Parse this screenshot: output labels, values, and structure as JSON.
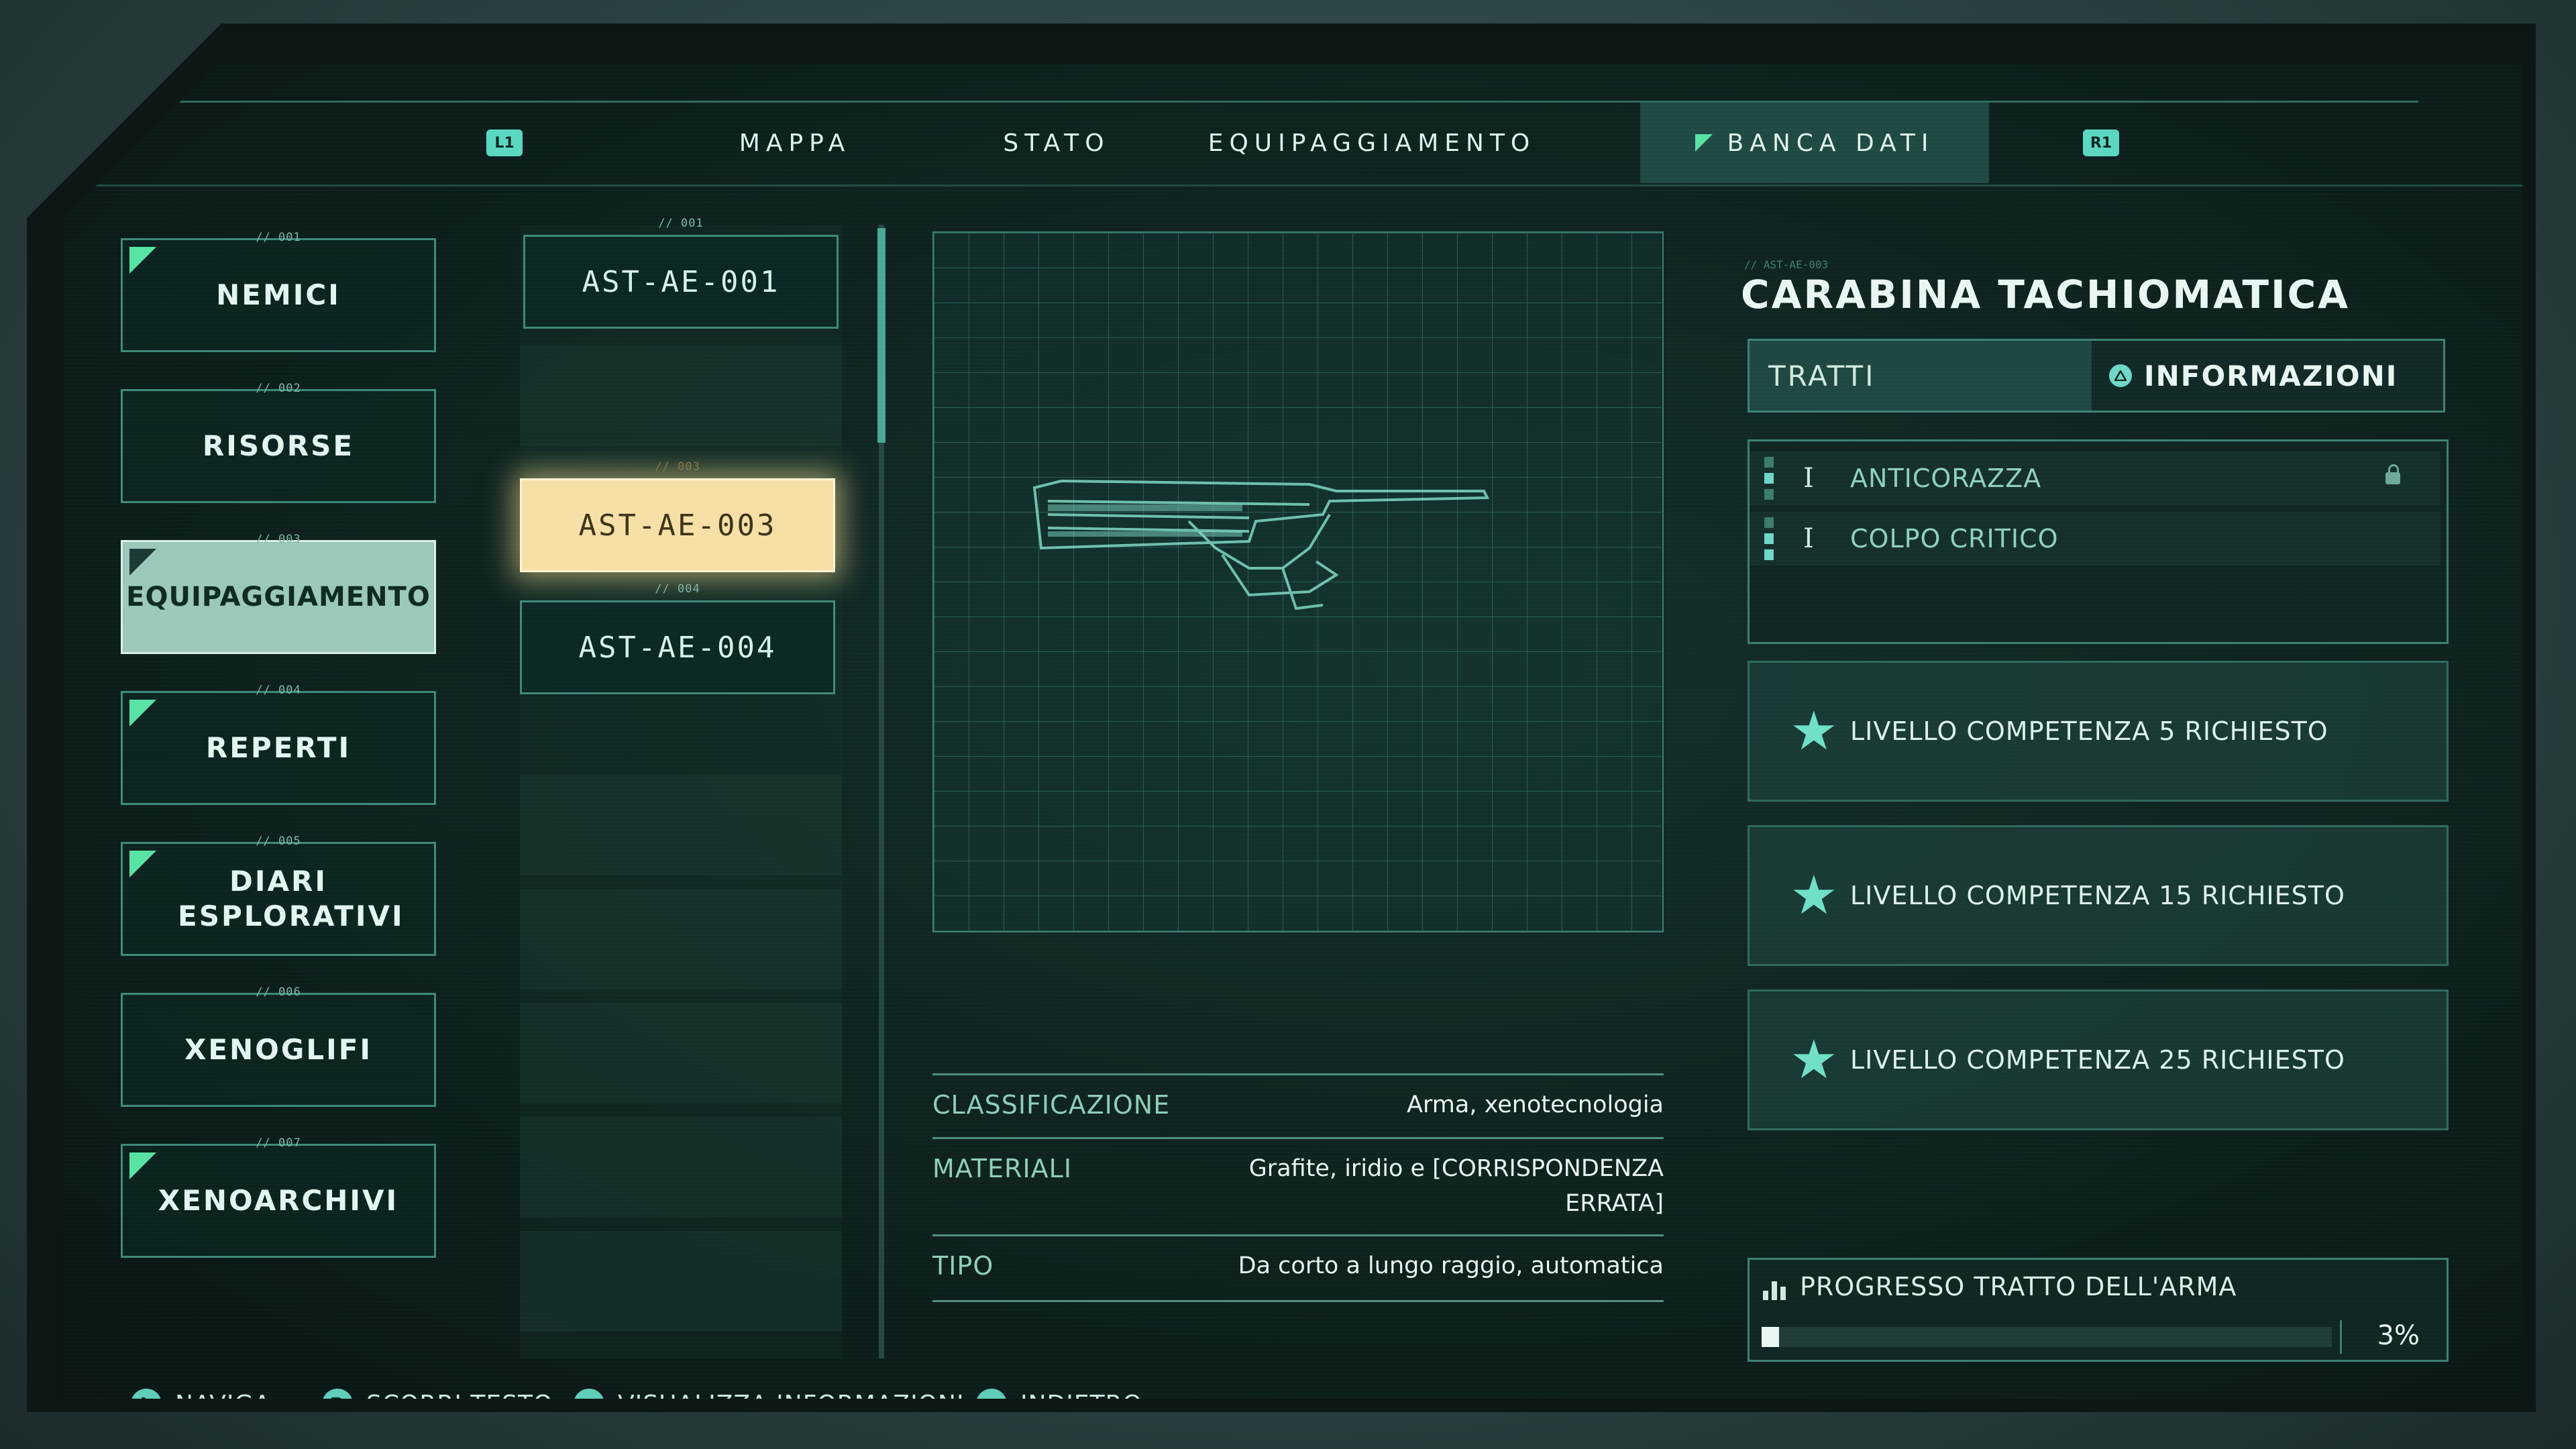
{
  "nav": {
    "left_button": "L1",
    "right_button": "R1",
    "tabs": [
      {
        "label": "MAPPA"
      },
      {
        "label": "STATO"
      },
      {
        "label": "EQUIPAGGIAMENTO"
      },
      {
        "label": "BANCA DATI"
      }
    ],
    "active_tab": "BANCA DATI"
  },
  "categories": [
    {
      "num": "// 001",
      "label": "NEMICI",
      "flag": true
    },
    {
      "num": "// 002",
      "label": "RISORSE",
      "flag": false
    },
    {
      "num": "// 003",
      "label": "EQUIPAGGIAMENTO",
      "flag": true,
      "active": true
    },
    {
      "num": "// 004",
      "label": "REPERTI",
      "flag": true
    },
    {
      "num": "// 005",
      "label": "DIARI ESPLORATIVI",
      "flag": true
    },
    {
      "num": "// 006",
      "label": "XENOGLIFI",
      "flag": false
    },
    {
      "num": "// 007",
      "label": "XENOARCHIVI",
      "flag": true
    }
  ],
  "items": [
    {
      "num": "// 001",
      "label": "AST-AE-001"
    },
    {
      "num": "// 003",
      "label": "AST-AE-003",
      "selected": true
    },
    {
      "num": "// 004",
      "label": "AST-AE-004"
    }
  ],
  "details": {
    "classificazione": {
      "key": "CLASSIFICAZIONE",
      "value": "Arma, xenotecnologia"
    },
    "materiali": {
      "key": "MATERIALI",
      "value_line1": "Grafite, iridio e [CORRISPONDENZA",
      "value_line2": "ERRATA]"
    },
    "tipo": {
      "key": "TIPO",
      "value": "Da corto a lungo raggio, automatica"
    }
  },
  "weapon": {
    "code": "// AST-AE-003",
    "name": "CARABINA TACHIOMATICA",
    "tab_traits": "TRATTI",
    "tab_info": "INFORMAZIONI",
    "traits": [
      {
        "rank": "I",
        "name": "ANTICORAZZA",
        "locked": true
      },
      {
        "rank": "I",
        "name": "COLPO CRITICO",
        "locked": false
      }
    ],
    "requirements": [
      {
        "text": "LIVELLO COMPETENZA 5 RICHIESTO"
      },
      {
        "text": "LIVELLO COMPETENZA 15 RICHIESTO"
      },
      {
        "text": "LIVELLO COMPETENZA 25 RICHIESTO"
      }
    ],
    "progress": {
      "label": "PROGRESSO TRATTO DELL'ARMA",
      "value_text": "3%",
      "value": 3
    }
  },
  "footer": [
    {
      "button": "L",
      "label": "NAVIGA"
    },
    {
      "button": "R",
      "label": "SCORRI TESTO"
    },
    {
      "button": "△",
      "label": "VISUALIZZA INFORMAZIONI"
    },
    {
      "button": "□",
      "label": "INDIETRO"
    }
  ],
  "colors": {
    "accent": "#58e3a5",
    "selected": "#f6e0a6",
    "panel": "#0d201e"
  }
}
